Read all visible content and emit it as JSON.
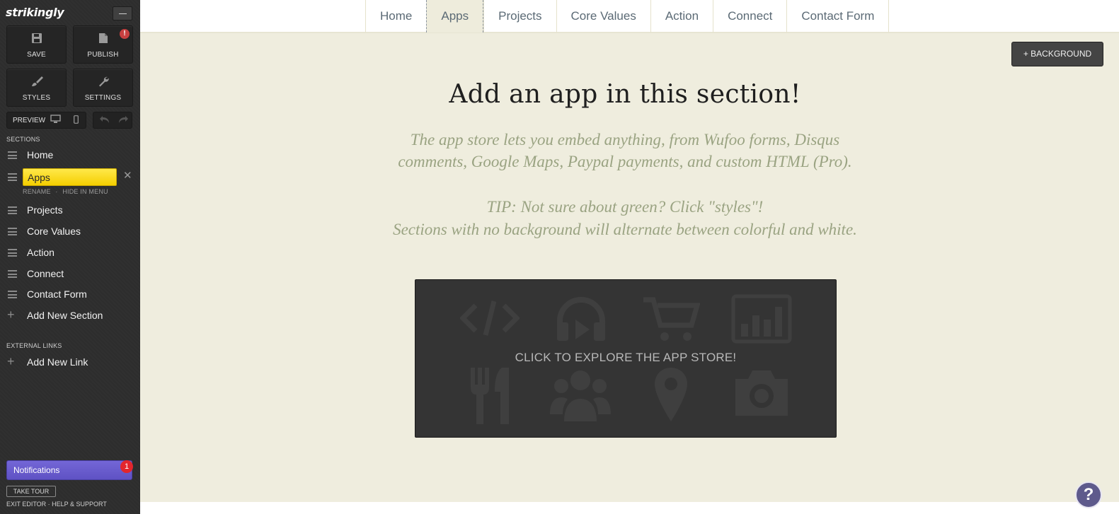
{
  "app": {
    "logo": "strikingly"
  },
  "toolbar": {
    "save_label": "SAVE",
    "publish_label": "PUBLISH",
    "publish_alert": "!",
    "styles_label": "STYLES",
    "settings_label": "SETTINGS",
    "preview_label": "PREVIEW"
  },
  "sidebar": {
    "sections_heading": "SECTIONS",
    "items": [
      {
        "label": "Home"
      },
      {
        "label": "Apps",
        "active": true
      },
      {
        "label": "Projects"
      },
      {
        "label": "Core Values"
      },
      {
        "label": "Action"
      },
      {
        "label": "Connect"
      },
      {
        "label": "Contact Form"
      }
    ],
    "active_actions": {
      "rename": "RENAME",
      "separator": "·",
      "hide": "HIDE IN MENU"
    },
    "add_section": "Add New Section",
    "external_heading": "EXTERNAL LINKS",
    "add_link": "Add New Link",
    "notifications": {
      "label": "Notifications",
      "count": "1"
    },
    "take_tour": "TAKE TOUR",
    "footer": "EXIT EDITOR · HELP & SUPPORT"
  },
  "topnav": {
    "items": [
      "Home",
      "Apps",
      "Projects",
      "Core Values",
      "Action",
      "Connect",
      "Contact Form"
    ],
    "active_index": 1
  },
  "section": {
    "background_button": "+ BACKGROUND",
    "headline": "Add an app in this section!",
    "desc_line1": "The app store lets you embed anything, from Wufoo forms, Disqus",
    "desc_line2": "comments, Google Maps, Paypal payments, and custom HTML (Pro).",
    "tip_line1": "TIP: Not sure about green? Click \"styles\"!",
    "tip_line2": "Sections with no background will alternate between colorful and white.",
    "app_store_label": "CLICK TO EXPLORE THE APP STORE!"
  },
  "help": {
    "label": "?"
  },
  "colors": {
    "sidebar_bg": "#2e2e2e",
    "active_item": "#f5d400",
    "section_bg": "#efedde",
    "notifications": "#6a5ecf",
    "desc_text": "#9aa382"
  }
}
